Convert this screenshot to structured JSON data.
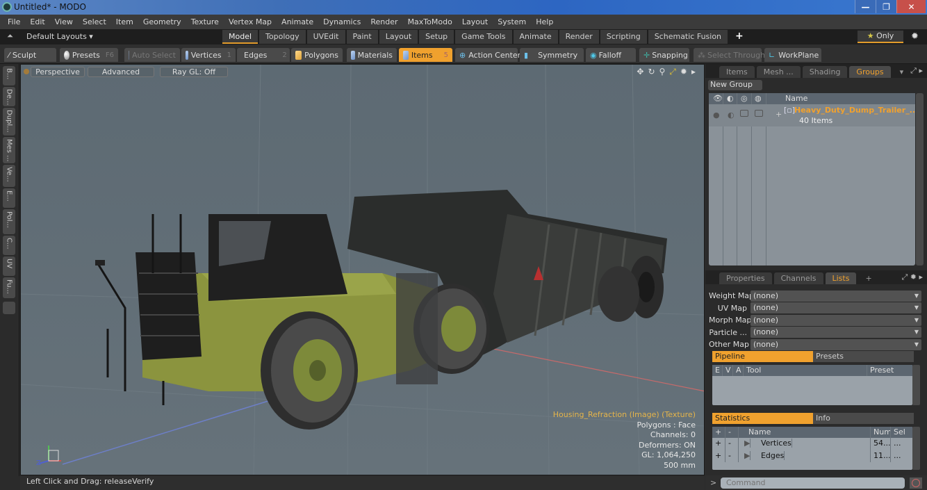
{
  "window": {
    "title": "Untitled* - MODO",
    "controls": [
      "minimize",
      "restore",
      "close"
    ]
  },
  "menu": [
    "File",
    "Edit",
    "View",
    "Select",
    "Item",
    "Geometry",
    "Texture",
    "Vertex Map",
    "Animate",
    "Dynamics",
    "Render",
    "MaxToModo",
    "Layout",
    "System",
    "Help"
  ],
  "layoutbar": {
    "default_layouts": "Default Layouts ▾",
    "tabs": [
      "Model",
      "Topology",
      "UVEdit",
      "Paint",
      "Layout",
      "Setup",
      "Game Tools",
      "Animate",
      "Render",
      "Scripting",
      "Schematic Fusion"
    ],
    "active_tab": "Model",
    "add": "+",
    "only": "Only"
  },
  "toolbar": {
    "sculpt": "Sculpt",
    "presets": "Presets",
    "presets_key": "F6",
    "auto_select": "Auto Select",
    "vertices": "Vertices",
    "vertices_key": "1",
    "edges": "Edges",
    "edges_key": "2",
    "polygons": "Polygons",
    "materials": "Materials",
    "items": "Items",
    "items_key": "5",
    "action_center": "Action Center",
    "symmetry": "Symmetry",
    "falloff": "Falloff",
    "snapping": "Snapping",
    "select_through": "Select Through",
    "workplane": "WorkPlane"
  },
  "left_tabs": [
    "B...",
    "De...",
    "Dupl...",
    "Mes ...",
    "Ve...",
    "E...",
    "Pol...",
    "C...",
    "UV",
    "Fu..."
  ],
  "viewport": {
    "view": "Perspective",
    "shading": "Advanced",
    "raygl": "Ray GL: Off",
    "info": {
      "texture": "Housing_Refraction (Image) (Texture)",
      "polygons": "Polygons : Face",
      "channels": "Channels: 0",
      "deformers": "Deformers: ON",
      "gl": "GL: 1,064,250",
      "scale": "500 mm"
    }
  },
  "status": {
    "hint": "Left Click and Drag:   releaseVerify"
  },
  "groups_panel": {
    "tabs": [
      "Items",
      "Mesh ...",
      "Shading",
      "Groups"
    ],
    "active": "Groups",
    "new_group": "New Group",
    "col_name": "Name",
    "rows": [
      {
        "name": "Heavy_Duty_Dump_Trailer_...",
        "count": "40 Items"
      }
    ]
  },
  "lists_panel": {
    "tabs": [
      "Properties",
      "Channels",
      "Lists"
    ],
    "active": "Lists",
    "add": "+",
    "maps": [
      {
        "label": "Weight Map",
        "value": "(none)"
      },
      {
        "label": "UV Map",
        "value": "(none)"
      },
      {
        "label": "Morph Map",
        "value": "(none)"
      },
      {
        "label": "Particle ...",
        "value": "(none)"
      },
      {
        "label": "Other Map",
        "value": "(none)"
      }
    ],
    "pipeline_tabs": [
      "Pipeline",
      "Presets"
    ],
    "pipeline_cols": [
      "E",
      "V",
      "A",
      "Tool",
      "Preset"
    ],
    "stats_tabs": [
      "Statistics",
      "Info"
    ],
    "stats_cols": [
      "+",
      "-",
      "Name",
      "Num",
      "Sel"
    ],
    "stats_rows": [
      {
        "plus": "+",
        "minus": "-",
        "name": "Vertices",
        "num": "54...",
        "sel": "..."
      },
      {
        "plus": "+",
        "minus": "-",
        "name": "Edges",
        "num": "11...",
        "sel": "..."
      }
    ]
  },
  "command": {
    "prompt": ">",
    "placeholder": "Command"
  }
}
